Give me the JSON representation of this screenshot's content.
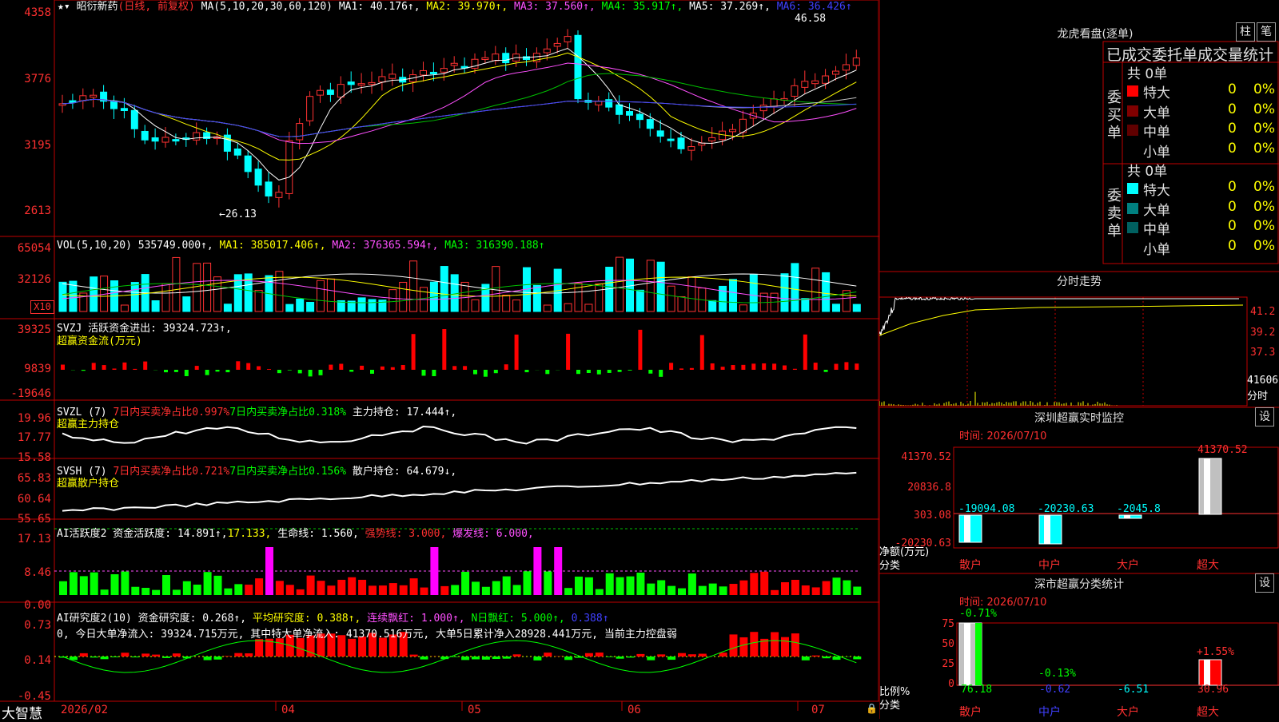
{
  "stock": {
    "name": "昭衍新药",
    "period": "(日线, 前复权)"
  },
  "main_pane": {
    "ma_label": "MA(5,10,20,30,60,120)",
    "ma1": "MA1: 40.176↑,",
    "ma2": "MA2: 39.970↑,",
    "ma3": "MA3: 37.560↑,",
    "ma4": "MA4: 35.917↑,",
    "ma5": "MA5: 37.269↑,",
    "ma6": "MA6: 36.426↑",
    "y_ticks": [
      "4358",
      "3776",
      "3195",
      "2613"
    ],
    "high_marker": "46.58",
    "low_marker": "←26.13"
  },
  "vol_pane": {
    "label": "VOL(5,10,20)",
    "value": "535749.000↑,",
    "ma1": "MA1: 385017.406↑,",
    "ma2": "MA2: 376365.594↑,",
    "ma3": "MA3: 316390.188↑",
    "y_ticks": [
      "65054",
      "32126"
    ],
    "unit": "X10"
  },
  "svzj_pane": {
    "label": "SVZJ  活跃资金进出: 39324.723↑,",
    "sublabel": "超赢资金流(万元)",
    "y_ticks": [
      "39325",
      "9839",
      "-19646"
    ]
  },
  "svzl_pane": {
    "label": "SVZL (7)",
    "a": "7日内买卖净占比0.997%",
    "b": "7日内买卖净占比0.318%",
    "c": "主力持仓: 17.444↑,",
    "sublabel": "超赢主力持仓",
    "y_ticks": [
      "19.96",
      "17.77",
      "15.58"
    ]
  },
  "svsh_pane": {
    "label": "SVSH (7)",
    "a": "7日内买卖净占比0.721%",
    "b": "7日内买卖净占比0.156%",
    "c": "散户持仓: 64.679↓,",
    "sublabel": "超赢散户持仓",
    "y_ticks": [
      "65.83",
      "60.64",
      "55.65"
    ]
  },
  "ai_pane": {
    "label": "AI活跃度2 资金活跃度: 14.891↑,",
    "v2": "17.133,",
    "life": "生命线: 1.560,",
    "strong": "强势线: 3.000,",
    "burst": "爆发线: 6.000,",
    "y_ticks": [
      "17.13",
      "8.46",
      "0.00"
    ]
  },
  "research_pane": {
    "label": "AI研究度2(10) 资金研究度: 0.268↑,",
    "avg": "平均研究度: 0.388↑,",
    "red": "连续飘红: 1.000↑,",
    "nred": "N日飘红: 5.000↑,",
    "tail": "0.388↑",
    "note": "0, 今日大单净流入: 39324.715万元, 其中特大单净流入: 41370.516万元, 大单5日累计净入28928.441万元, 当前主力控盘弱",
    "y_ticks": [
      "0.73",
      "0.14",
      "-0.45"
    ]
  },
  "x_axis": {
    "labels": [
      "2026/02",
      "04",
      "05",
      "06",
      "07"
    ],
    "brand": "大智慧"
  },
  "right_panel": {
    "dragon_title": "龙虎看盘(逐单)",
    "btn_pillar": "柱",
    "btn_pen": "笔",
    "order_title": "已成交委托单成交量统计",
    "buy_side": "委买单",
    "sell_side": "委卖单",
    "buy_total": "共 0单",
    "sell_total": "共 0单",
    "buy_rows": [
      {
        "label": "特大",
        "count": "0",
        "pct": "0%",
        "color": "#ff0000"
      },
      {
        "label": "大单",
        "count": "0",
        "pct": "0%",
        "color": "#800000"
      },
      {
        "label": "中单",
        "count": "0",
        "pct": "0%",
        "color": "#600000"
      },
      {
        "label": "小单",
        "count": "0",
        "pct": "0%",
        "color": "#000000"
      }
    ],
    "sell_rows": [
      {
        "label": "特大",
        "count": "0",
        "pct": "0%",
        "color": "#00ffff"
      },
      {
        "label": "大单",
        "count": "0",
        "pct": "0%",
        "color": "#008080"
      },
      {
        "label": "中单",
        "count": "0",
        "pct": "0%",
        "color": "#006060"
      },
      {
        "label": "小单",
        "count": "0",
        "pct": "0%",
        "color": "#000000"
      }
    ],
    "intraday_title": "分时走势",
    "intraday_ticks": [
      "41.2",
      "39.2",
      "37.3",
      "41606",
      "分时"
    ],
    "sz_title": "深圳超赢实时监控",
    "sz_btn": "设",
    "sz_time": "时间: 2026/07/10",
    "sz_y": [
      "41370.52",
      "20836.8",
      "303.08",
      "-20230.63"
    ],
    "sz_values": [
      "-19094.08",
      "-20230.63",
      "-2045.8",
      "41370.52"
    ],
    "sz_ylabel": "净额(万元)",
    "sz_xlabel": "分类",
    "categories": [
      "散户",
      "中户",
      "大户",
      "超大"
    ],
    "sc_title": "深市超赢分类统计",
    "sc_btn": "设",
    "sc_time": "时间: 2026/07/10",
    "sc_y": [
      "75",
      "50",
      "25",
      "0"
    ],
    "sc_top": [
      "-0.71%",
      "-0.13%",
      "+1.55%"
    ],
    "sc_values": [
      "76.18",
      "-0.62",
      "-6.51",
      "30.96"
    ],
    "sc_ylabel": "比例%",
    "sc_xlabel": "分类"
  },
  "colors": {
    "up": "#ff3232",
    "down": "#00ffff",
    "grid": "#c00000",
    "inflow": "#ff0000",
    "outflow": "#00ff00"
  }
}
